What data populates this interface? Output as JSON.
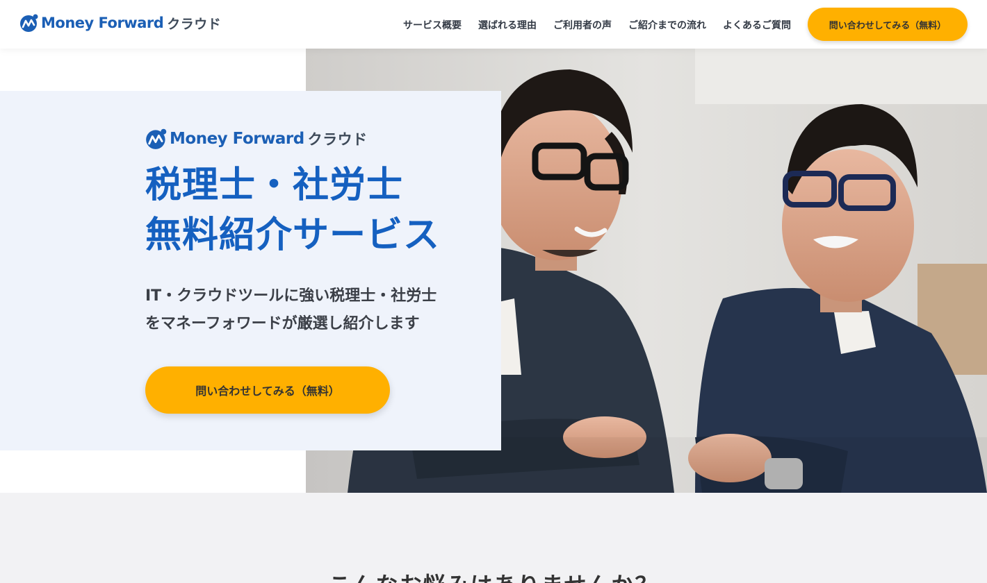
{
  "brand": {
    "name": "Money Forward",
    "sub": "クラウド",
    "color": "#1b5fb5"
  },
  "nav": {
    "items": [
      {
        "label": "サービス概要"
      },
      {
        "label": "選ばれる理由"
      },
      {
        "label": "ご利用者の声"
      },
      {
        "label": "ご紹介までの流れ"
      },
      {
        "label": "よくあるご質問"
      }
    ],
    "cta_label": "問い合わせしてみる（無料）"
  },
  "hero": {
    "title_line1": "税理士・社労士",
    "title_line2": "無料紹介サービス",
    "desc_line1": "IT・クラウドツールに強い税理士・社労士",
    "desc_line2": "をマネーフォワードが厳選し紹介します",
    "cta_label": "問い合わせしてみる（無料）",
    "title_color": "#1560c0",
    "card_color": "#eff3fb"
  },
  "problems": {
    "heading": "こんなお悩みはありませんか？"
  },
  "colors": {
    "accent": "#ffb000",
    "section_bg": "#f2f2f4"
  }
}
